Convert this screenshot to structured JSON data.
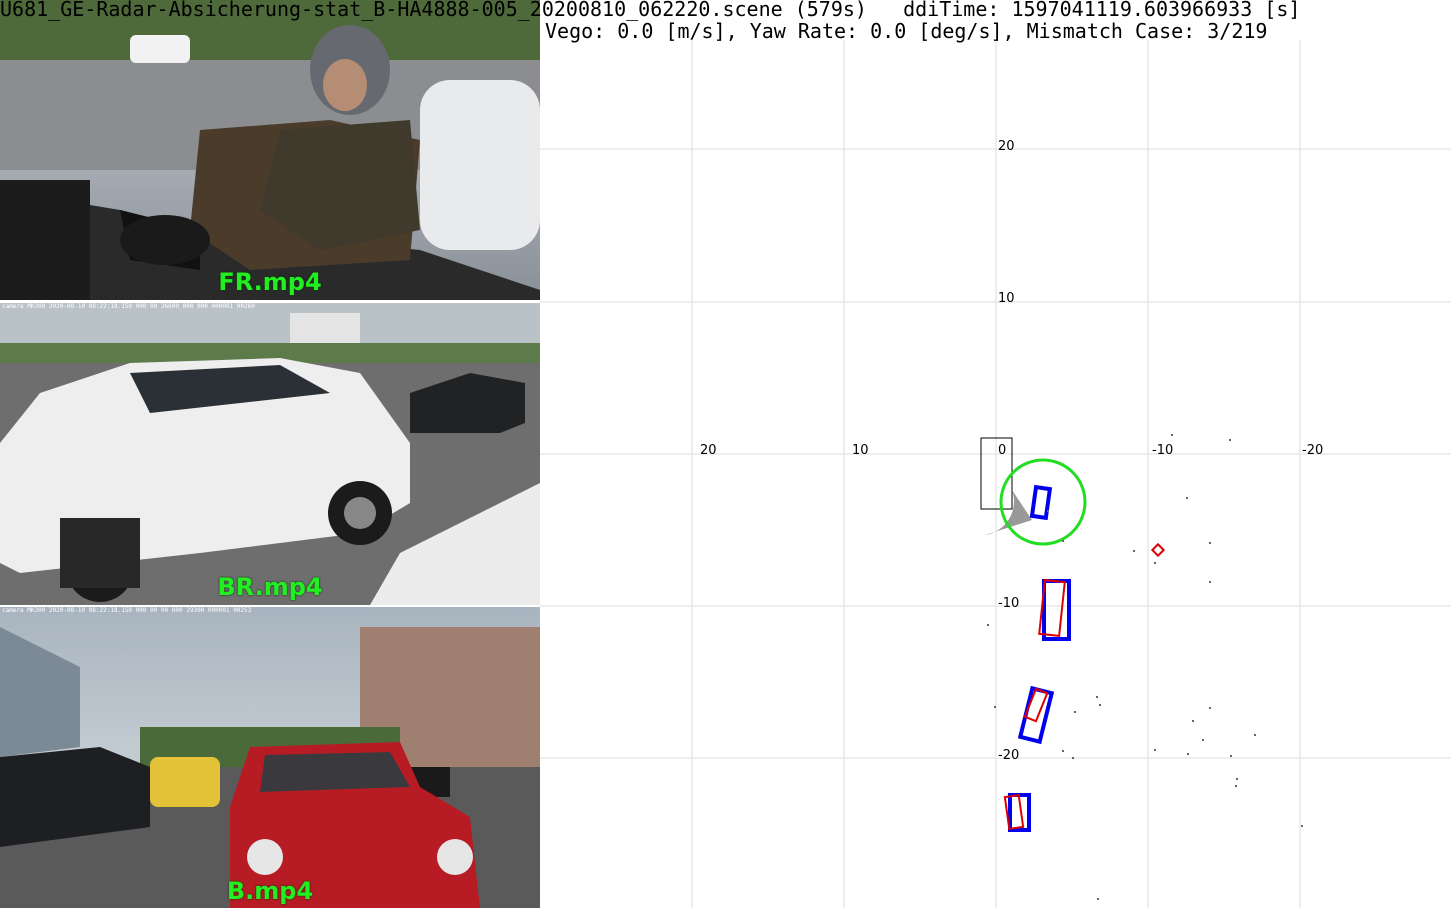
{
  "header": {
    "line1": "U681_GE-Radar-Absicherung-stat_B-HA4888-005_20200810_062220.scene (579s)   ddiTime: 1597041119.603966933 [s]",
    "line2": "Vego: 0.0 [m/s], Yaw Rate: 0.0 [deg/s], Mismatch Case: 3/219"
  },
  "cameras": [
    {
      "id": "fr",
      "label": "FR.mp4",
      "overlay": ""
    },
    {
      "id": "br",
      "label": "BR.mp4",
      "overlay": "camera MK300 2020-08-10 08:22:18.150  000 00 26600 000 000 000001 00260"
    },
    {
      "id": "b",
      "label": "B.mp4",
      "overlay": "camera MK300 2020-08-10 08:22:18.150 000 00 00 000 29300 000001 00253"
    }
  ],
  "radar": {
    "x_ticks": [
      "20",
      "10",
      "0",
      "-10",
      "-20"
    ],
    "y_ticks": [
      "20",
      "10",
      "-10",
      "-20"
    ],
    "colors": {
      "grid": "#dddddd",
      "blue_track": "#0000ee",
      "red_track": "#dd0000",
      "fov_circle": "#22dd22",
      "sensor_sector": "#999999",
      "points": "#666666"
    },
    "objects": [
      {
        "type": "ego-vehicle-box"
      },
      {
        "type": "fov-circle"
      },
      {
        "type": "blue-box"
      },
      {
        "type": "red-diamond"
      }
    ]
  }
}
